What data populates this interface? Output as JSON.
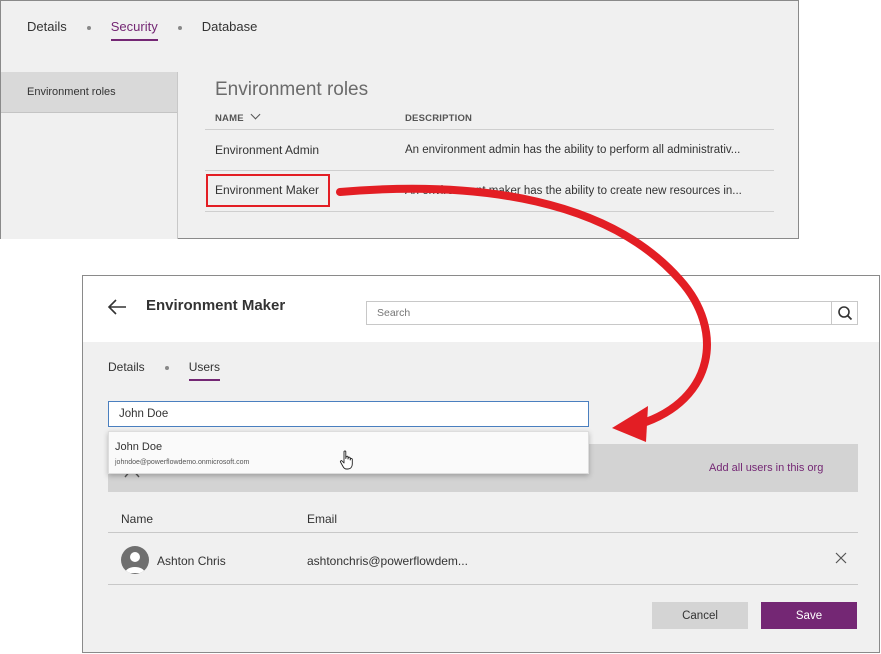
{
  "top": {
    "tabs": [
      {
        "label": "Details"
      },
      {
        "label": "Security"
      },
      {
        "label": "Database"
      }
    ],
    "sidebar": {
      "items": [
        {
          "label": "Environment roles"
        }
      ]
    },
    "roles": {
      "title": "Environment roles",
      "columns": {
        "name": "NAME",
        "description": "DESCRIPTION"
      },
      "rows": [
        {
          "name": "Environment Admin",
          "description": "An environment admin has the ability to perform all administrativ..."
        },
        {
          "name": "Environment Maker",
          "description": "An environment maker has the ability to create new resources in..."
        }
      ]
    }
  },
  "detail": {
    "title": "Environment Maker",
    "search": {
      "placeholder": "Search"
    },
    "tabs": [
      {
        "label": "Details"
      },
      {
        "label": "Users"
      }
    ],
    "user_input": {
      "value": "John Doe"
    },
    "suggestion": {
      "name": "John Doe",
      "email": "johndoe@powerflowdemo.onmicrosoft.com"
    },
    "add_all_label": "Add all users in this org",
    "table": {
      "columns": {
        "name": "Name",
        "email": "Email"
      },
      "rows": [
        {
          "name": "Ashton Chris",
          "email": "ashtonchris@powerflowdem..."
        }
      ]
    },
    "buttons": {
      "cancel": "Cancel",
      "save": "Save"
    }
  },
  "colors": {
    "accent": "#742774",
    "highlight": "#e31e24",
    "input_focus": "#4a7fbf"
  }
}
